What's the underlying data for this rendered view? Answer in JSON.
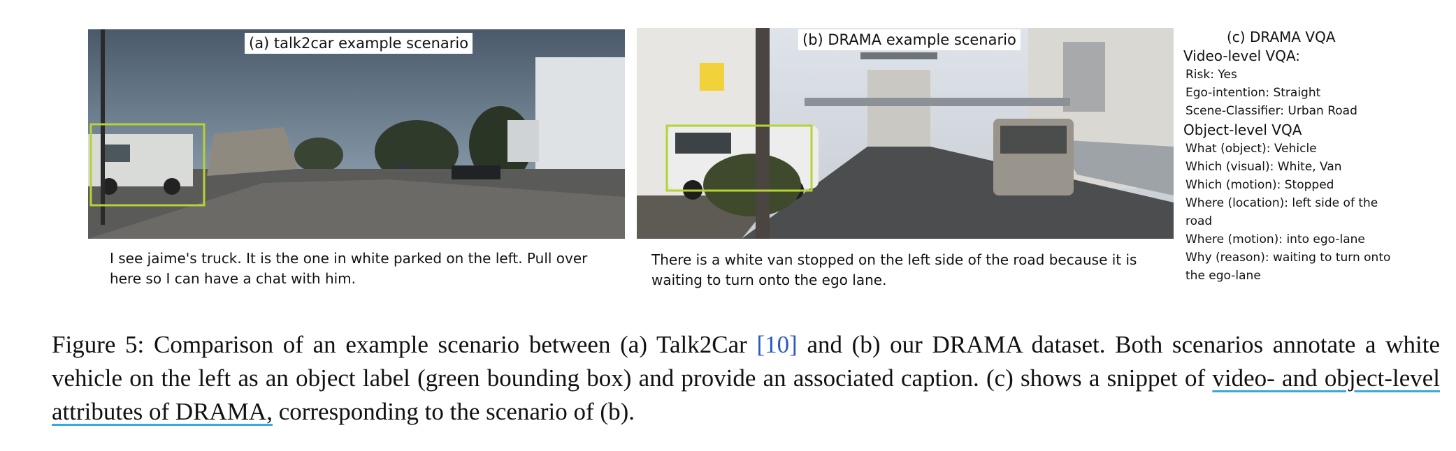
{
  "panel_a": {
    "title": "(a) talk2car example scenario",
    "caption": "I see jaime's truck. It is the one in white parked on the left. Pull over here so I can have a chat with him."
  },
  "panel_b": {
    "title": "(b) DRAMA example scenario",
    "caption": "There is a white van stopped on the left side of the road because it is waiting to turn onto the ego lane."
  },
  "panel_c": {
    "title": "(c) DRAMA VQA",
    "video_level": {
      "heading": "Video-level VQA:",
      "items": [
        "Risk: Yes",
        "Ego-intention: Straight",
        "Scene-Classifier: Urban Road"
      ]
    },
    "object_level": {
      "heading": "Object-level VQA",
      "items": [
        "What (object): Vehicle",
        "Which (visual): White, Van",
        "Which (motion): Stopped",
        "Where (location): left side of the road",
        "Where (motion): into ego-lane",
        "Why (reason): waiting to turn onto the ego-lane"
      ]
    }
  },
  "figure_caption": {
    "label": "Figure 5:",
    "part1": "Comparison of an example scenario between (a) Talk2Car",
    "ref": "[10]",
    "part2": "and (b) our DRAMA dataset. Both scenarios annotate a white vehicle on the left as an object label (green bounding box) and provide an associated caption. (c) shows a snippet of",
    "highlight": "video- and object-level attributes of DRAMA,",
    "part3": "corresponding to the scenario of (b)."
  },
  "colors": {
    "bounding_box": "#b5d334",
    "link_underline": "#3aa7e0",
    "citation": "#2b59c3"
  }
}
